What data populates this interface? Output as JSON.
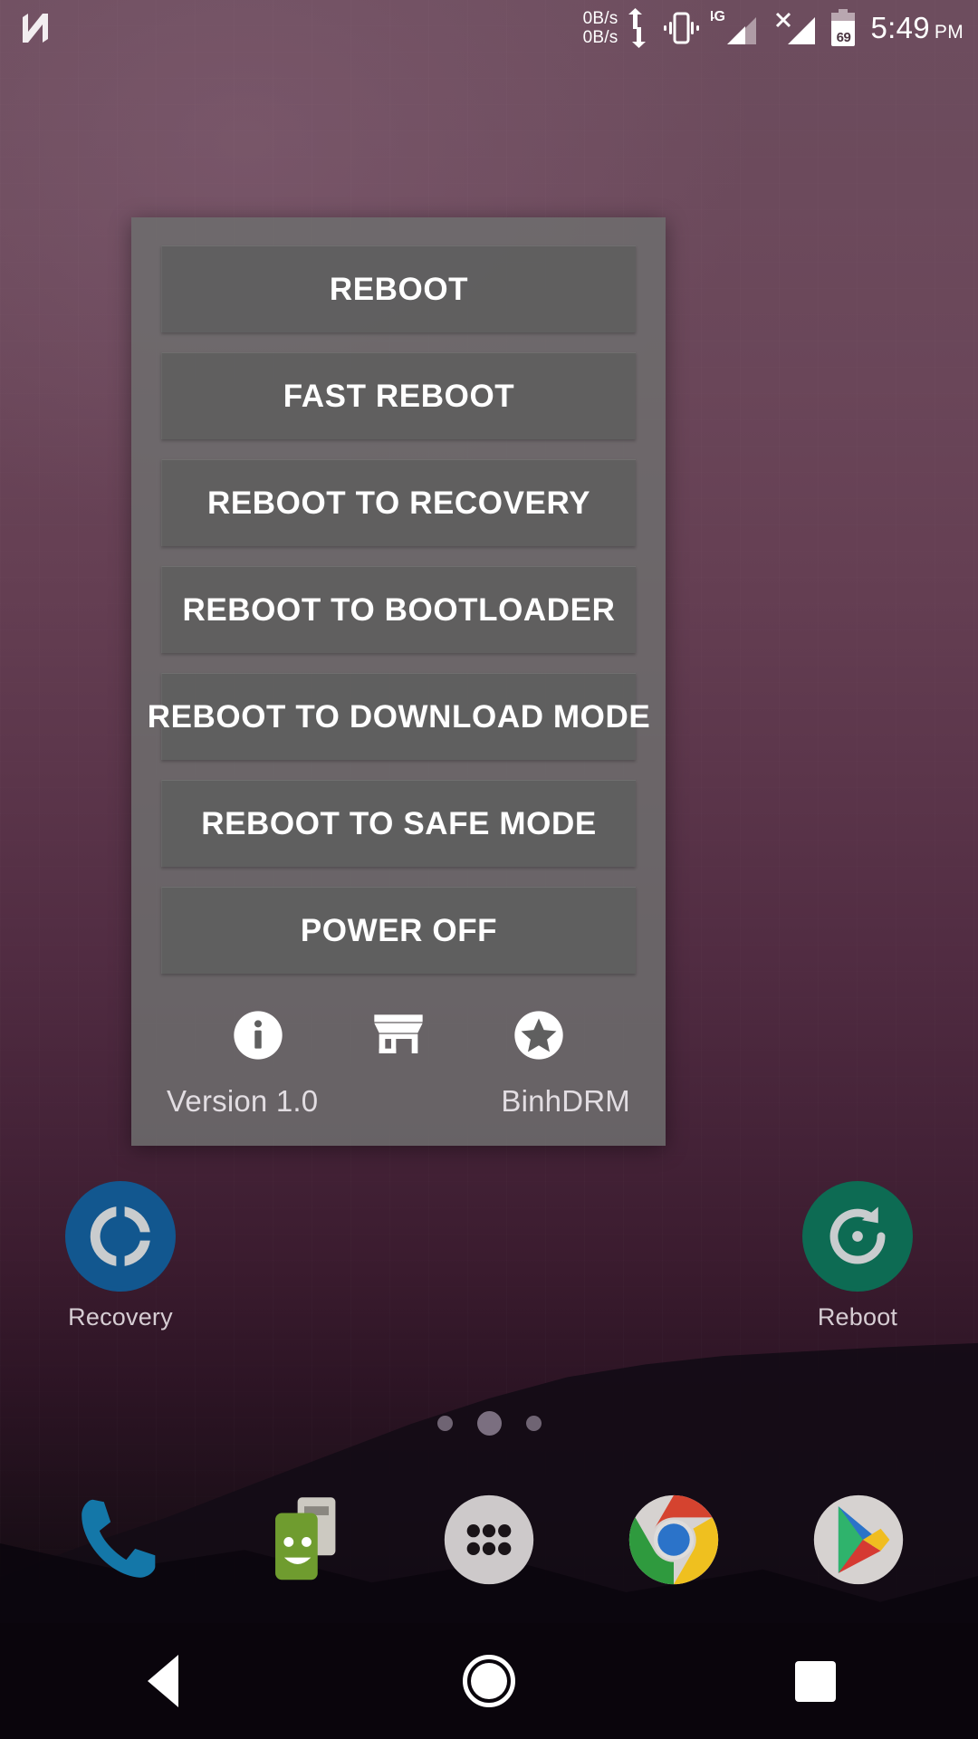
{
  "status_bar": {
    "logo_icon": "android-n-logo-icon",
    "net_speed_up": "0B/s",
    "net_speed_down": "0B/s",
    "speed_arrows_icon": "up-down-arrows-icon",
    "vibrate_icon": "vibrate-icon",
    "signal1_label": "4G",
    "signal1_icon": "signal-bars-icon",
    "signal2_icon": "no-sim-signal-icon",
    "no_sim_mark": "×",
    "battery_icon": "battery-icon",
    "battery_level": "69",
    "time": "5:49",
    "am_pm": "PM"
  },
  "dialog": {
    "name": "reboot-options-dialog",
    "options": [
      {
        "label": "REBOOT",
        "name": "reboot-button"
      },
      {
        "label": "FAST REBOOT",
        "name": "fast-reboot-button"
      },
      {
        "label": "REBOOT TO RECOVERY",
        "name": "reboot-to-recovery-button"
      },
      {
        "label": "REBOOT TO BOOTLOADER",
        "name": "reboot-to-bootloader-button"
      },
      {
        "label": "REBOOT TO DOWNLOAD MODE",
        "name": "reboot-to-download-mode-button"
      },
      {
        "label": "REBOOT TO SAFE MODE",
        "name": "reboot-to-safe-mode-button"
      },
      {
        "label": "POWER OFF",
        "name": "power-off-button"
      }
    ],
    "footer_icons": [
      {
        "icon": "info-icon",
        "name": "about-info-button"
      },
      {
        "icon": "store-icon",
        "name": "more-apps-store-button"
      },
      {
        "icon": "star-icon",
        "name": "rate-app-star-button"
      }
    ],
    "version": "Version 1.0",
    "developer": "BinhDRM"
  },
  "home_screen": {
    "apps": [
      {
        "label": "Recovery",
        "icon": "recovery-app-icon",
        "color": "#12578f"
      },
      {
        "label": "Reboot",
        "icon": "reboot-app-icon",
        "color": "#0d6b53"
      }
    ],
    "page_dots": 3,
    "active_dot": 2,
    "dock": [
      {
        "name": "phone-app-icon",
        "icon": "phone-icon"
      },
      {
        "name": "messaging-app-icon",
        "icon": "messaging-icon"
      },
      {
        "name": "app-drawer-button",
        "icon": "app-drawer-icon"
      },
      {
        "name": "chrome-app-icon",
        "icon": "chrome-icon"
      },
      {
        "name": "play-store-app-icon",
        "icon": "play-store-icon"
      }
    ]
  },
  "nav_bar": {
    "back": "back-icon",
    "home": "home-icon",
    "recents": "recents-icon"
  },
  "colors": {
    "dialog_bg": "#6e6e6e",
    "button_bg": "#5f5f5f",
    "text": "#ffffff",
    "wallpaper_top": "#6d4d5e",
    "wallpaper_bottom": "#0a060b"
  }
}
